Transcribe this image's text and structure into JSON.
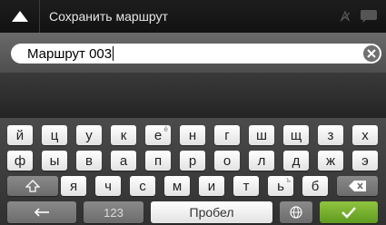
{
  "header": {
    "back_icon": "up-triangle-icon",
    "title": "Сохранить маршрут",
    "status_icons": [
      "gps-icon",
      "message-icon"
    ]
  },
  "input": {
    "value": "Маршрут 003",
    "clear_icon": "clear-x-icon"
  },
  "keyboard": {
    "row1": [
      "й",
      "ц",
      "у",
      "к",
      "е",
      "н",
      "г",
      "ш",
      "щ",
      "з",
      "х"
    ],
    "row1_alt": {
      "e_index": 4,
      "alt": "ё"
    },
    "row2": [
      "ф",
      "ы",
      "в",
      "а",
      "п",
      "р",
      "о",
      "л",
      "д",
      "ж",
      "э"
    ],
    "row3": [
      "я",
      "ч",
      "с",
      "м",
      "и",
      "т",
      "ь",
      "б"
    ],
    "row3_alt": {
      "index": 6,
      "alt": "ъ"
    },
    "shift_icon": "shift-arrow-icon",
    "backspace_icon": "backspace-icon",
    "left_arrow_icon": "left-arrow-icon",
    "numbers_label": "123",
    "space_label": "Пробел",
    "globe_icon": "globe-icon",
    "done_icon": "checkmark-icon"
  }
}
